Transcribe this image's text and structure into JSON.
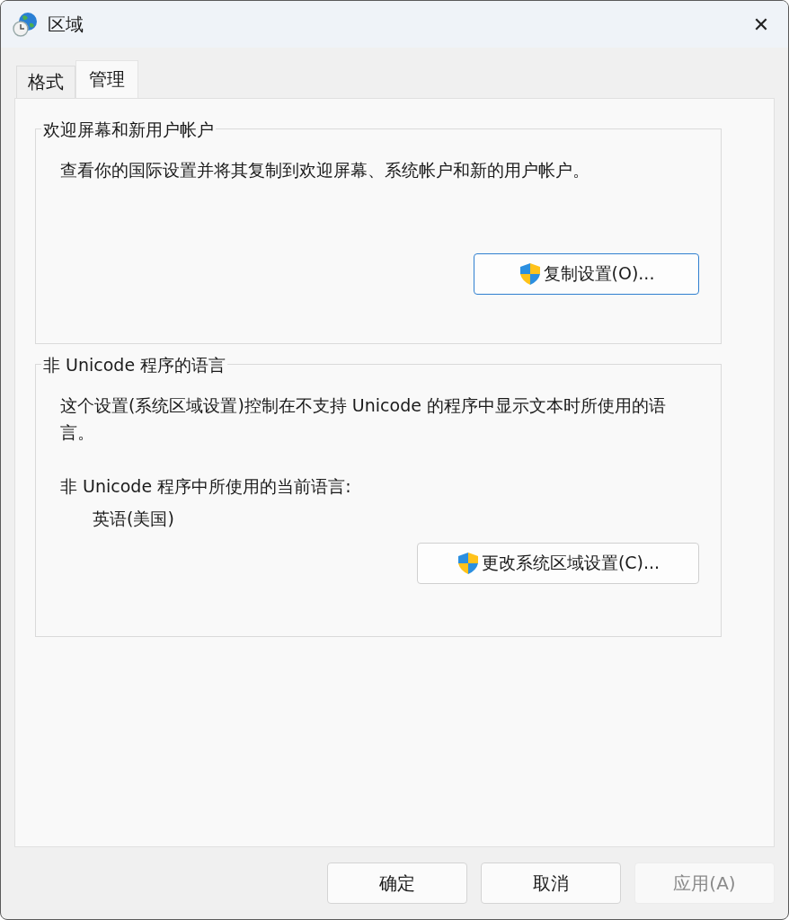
{
  "window": {
    "title": "区域",
    "close": "✕"
  },
  "tabs": [
    {
      "label": "格式",
      "selected": false
    },
    {
      "label": "管理",
      "selected": true
    }
  ],
  "groups": [
    {
      "title": "欢迎屏幕和新用户帐户",
      "description": "查看你的国际设置并将其复制到欢迎屏幕、系统帐户和新的用户帐户。",
      "button": {
        "label": "复制设置(O)...",
        "focused": true
      }
    },
    {
      "title": "非 Unicode 程序的语言",
      "description": "这个设置(系统区域设置)控制在不支持 Unicode 的程序中显示文本时所使用的语言。",
      "current_label": "非 Unicode 程序中所使用的当前语言:",
      "current_value": "英语(美国)",
      "button": {
        "label": "更改系统区域设置(C)...",
        "focused": false
      }
    }
  ],
  "footer_buttons": [
    {
      "label": "确定",
      "disabled": false
    },
    {
      "label": "取消",
      "disabled": false
    },
    {
      "label": "应用(A)",
      "disabled": true
    }
  ]
}
